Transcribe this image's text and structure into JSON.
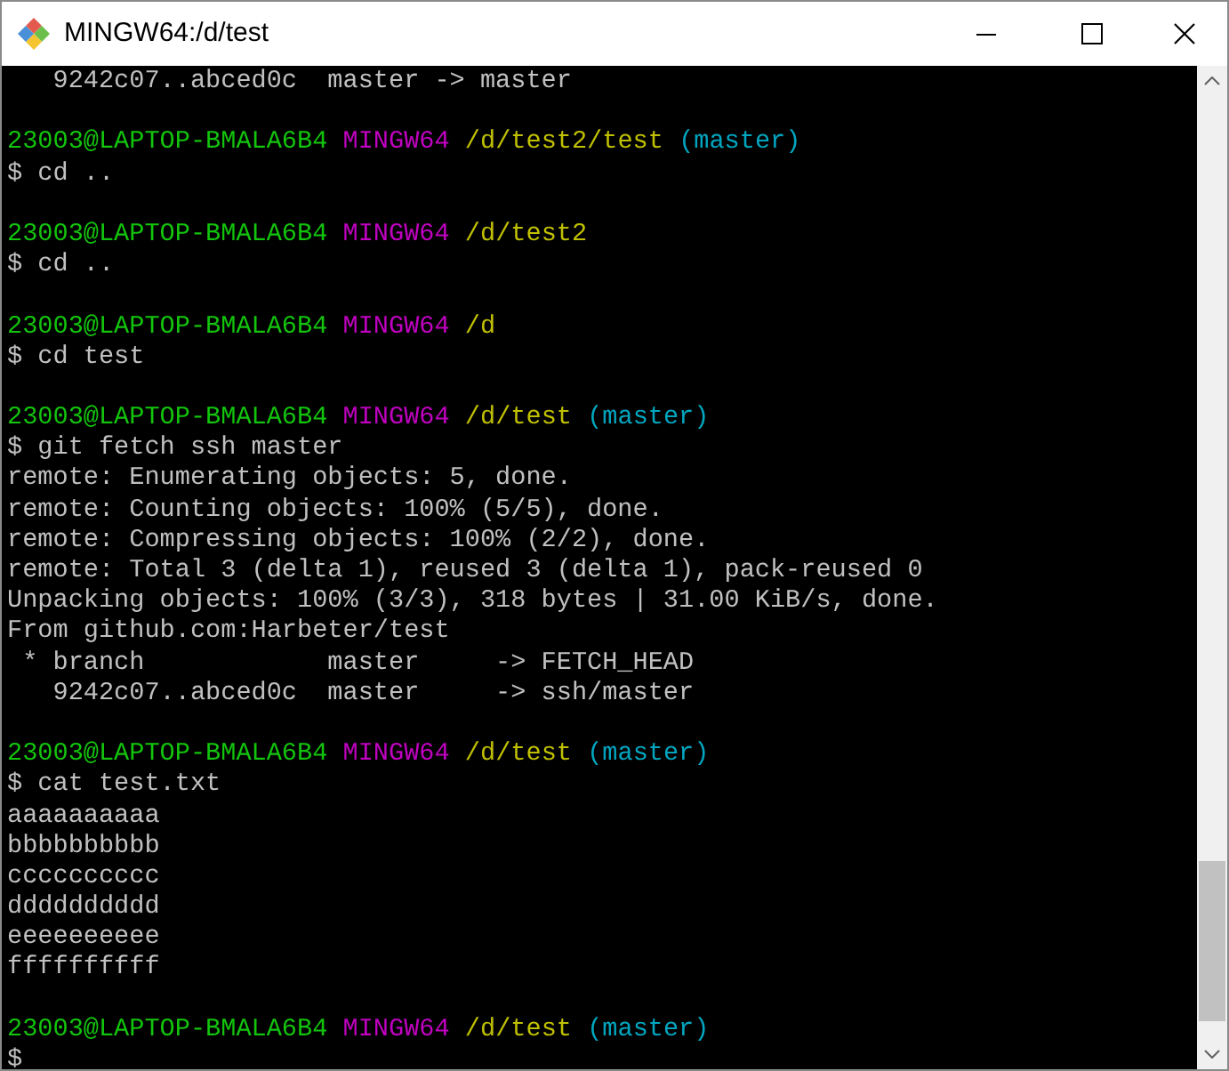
{
  "window": {
    "title": "MINGW64:/d/test"
  },
  "terminal": {
    "lines": [
      {
        "kind": "text",
        "text": "   9242c07..abced0c  master -> master"
      },
      {
        "kind": "blank"
      },
      {
        "kind": "prompt",
        "user": "23003@LAPTOP-BMALA6B4",
        "system": "MINGW64",
        "path": "/d/test2/test",
        "branch": "(master)"
      },
      {
        "kind": "text",
        "text": "$ cd .."
      },
      {
        "kind": "blank"
      },
      {
        "kind": "prompt",
        "user": "23003@LAPTOP-BMALA6B4",
        "system": "MINGW64",
        "path": "/d/test2"
      },
      {
        "kind": "text",
        "text": "$ cd .."
      },
      {
        "kind": "blank"
      },
      {
        "kind": "prompt",
        "user": "23003@LAPTOP-BMALA6B4",
        "system": "MINGW64",
        "path": "/d"
      },
      {
        "kind": "text",
        "text": "$ cd test"
      },
      {
        "kind": "blank"
      },
      {
        "kind": "prompt",
        "user": "23003@LAPTOP-BMALA6B4",
        "system": "MINGW64",
        "path": "/d/test",
        "branch": "(master)"
      },
      {
        "kind": "text",
        "text": "$ git fetch ssh master"
      },
      {
        "kind": "text",
        "text": "remote: Enumerating objects: 5, done."
      },
      {
        "kind": "text",
        "text": "remote: Counting objects: 100% (5/5), done."
      },
      {
        "kind": "text",
        "text": "remote: Compressing objects: 100% (2/2), done."
      },
      {
        "kind": "text",
        "text": "remote: Total 3 (delta 1), reused 3 (delta 1), pack-reused 0"
      },
      {
        "kind": "text",
        "text": "Unpacking objects: 100% (3/3), 318 bytes | 31.00 KiB/s, done."
      },
      {
        "kind": "text",
        "text": "From github.com:Harbeter/test"
      },
      {
        "kind": "text",
        "text": " * branch            master     -> FETCH_HEAD"
      },
      {
        "kind": "text",
        "text": "   9242c07..abced0c  master     -> ssh/master"
      },
      {
        "kind": "blank"
      },
      {
        "kind": "prompt",
        "user": "23003@LAPTOP-BMALA6B4",
        "system": "MINGW64",
        "path": "/d/test",
        "branch": "(master)"
      },
      {
        "kind": "text",
        "text": "$ cat test.txt"
      },
      {
        "kind": "text",
        "text": "aaaaaaaaaa"
      },
      {
        "kind": "text",
        "text": "bbbbbbbbbb"
      },
      {
        "kind": "text",
        "text": "cccccccccc"
      },
      {
        "kind": "text",
        "text": "dddddddddd"
      },
      {
        "kind": "text",
        "text": "eeeeeeeeee"
      },
      {
        "kind": "text",
        "text": "ffffffffff"
      },
      {
        "kind": "blank"
      },
      {
        "kind": "prompt",
        "user": "23003@LAPTOP-BMALA6B4",
        "system": "MINGW64",
        "path": "/d/test",
        "branch": "(master)"
      },
      {
        "kind": "text",
        "text": "$"
      }
    ]
  }
}
